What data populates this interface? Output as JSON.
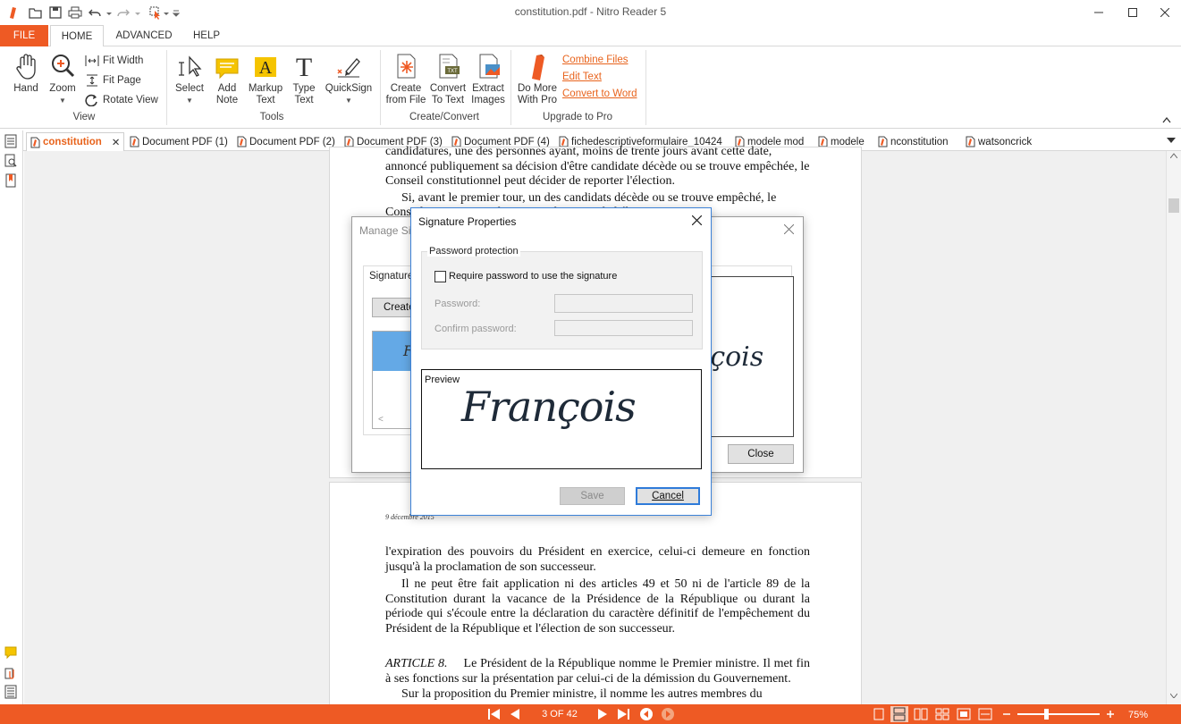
{
  "window": {
    "title": "constitution.pdf - Nitro Reader 5"
  },
  "ribbon_tabs": {
    "file": "FILE",
    "home": "HOME",
    "advanced": "ADVANCED",
    "help": "HELP"
  },
  "ribbon": {
    "view": {
      "hand": "Hand",
      "zoom": "Zoom",
      "fit_width": "Fit Width",
      "fit_page": "Fit Page",
      "rotate_view": "Rotate View",
      "label": "View"
    },
    "tools": {
      "select": "Select",
      "add_note_1": "Add",
      "add_note_2": "Note",
      "markup_1": "Markup",
      "markup_2": "Text",
      "type_1": "Type",
      "type_2": "Text",
      "quicksign": "QuickSign",
      "label": "Tools"
    },
    "create_convert": {
      "create_1": "Create",
      "create_2": "from File",
      "convert_1": "Convert",
      "convert_2": "To Text",
      "extract_1": "Extract",
      "extract_2": "Images",
      "label": "Create/Convert"
    },
    "upgrade": {
      "domore_1": "Do More",
      "domore_2": "With Pro",
      "combine": "Combine Files",
      "edit": "Edit Text",
      "convert_word": "Convert to Word",
      "label": "Upgrade to Pro"
    }
  },
  "doc_tabs": [
    "constitution",
    "Document PDF (1)",
    "Document PDF (2)",
    "Document PDF (3)",
    "Document PDF (4)",
    "fichedescriptiveformulaire_10424",
    "modele mod",
    "modele",
    "nconstitution",
    "watsoncrick"
  ],
  "document": {
    "page1_lines": [
      "candidatures, une des personnes ayant, moins de trente jours avant cette date,",
      "annoncé publiquement sa décision d'être candidate décède ou se trouve empêchée, le",
      "Conseil constitutionnel peut décider de reporter l'élection.",
      "Si, avant le premier tour, un des candidats décède ou se trouve empêché, le",
      "Conseil constitutionnel prononce le report de l'élection."
    ],
    "page2_header": "9 décembre 2015",
    "page2_paragraphs": [
      "l'expiration des pouvoirs du Président en exercice, celui-ci demeure en fonction jusqu'à la proclamation de son successeur.",
      "Il ne peut être fait application ni des articles 49 et 50 ni de l'article 89 de la Constitution durant la vacance de la Présidence de la République ou durant la période qui s'écoule entre la déclaration du caractère définitif de l'empêchement du Président de la République et l'élection de son successeur."
    ],
    "article_label": "ARTICLE 8.",
    "article_text": "Le Président de la République nomme le Premier ministre. Il met fin à ses fonctions sur la présentation par celui-ci de la démission du Gouvernement.",
    "last_line": "Sur la proposition du Premier ministre, il nomme les autres membres du"
  },
  "manage_dialog": {
    "title": "Manage Si",
    "signatures_label": "Signature",
    "create_button": "Create",
    "close_button": "Close",
    "list_item_initial": "F",
    "preview_fragment": "nçois"
  },
  "signature_dialog": {
    "title": "Signature Properties",
    "group_label": "Password protection",
    "checkbox_label": "Require password to use the signature",
    "password_label": "Password:",
    "confirm_label": "Confirm password:",
    "preview_label": "Preview",
    "signature": "François",
    "save_button": "Save",
    "cancel_button": "Cancel"
  },
  "status": {
    "page_indicator": "3 OF 42",
    "zoom": "75%"
  }
}
